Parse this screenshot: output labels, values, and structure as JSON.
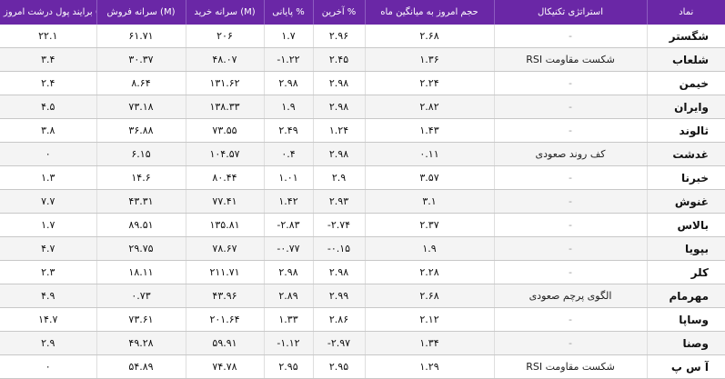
{
  "headers": {
    "c1": "برایند پول درشت امروز (B)",
    "c2": "سرانه فروش (M)",
    "c3": "سرانه خرید (M)",
    "c4": "پایانی %",
    "c5": "آخرین %",
    "c6": "حجم امروز به میانگین ماه",
    "c7": "استراتژی تکنیکال",
    "c8": "نماد"
  },
  "rows": [
    {
      "big_money": "۲۲.۱",
      "sell_per_capita": "۶۱.۷۱",
      "buy_per_capita": "۲۰۶",
      "close_pct": "۱.۷",
      "last_pct": "۲.۹۶",
      "vol_ratio": "۲.۶۸",
      "strategy": "-",
      "symbol": "شگستر"
    },
    {
      "big_money": "۳.۴",
      "sell_per_capita": "۳۰.۳۷",
      "buy_per_capita": "۴۸.۰۷",
      "close_pct": "-۱.۲۲",
      "last_pct": "۲.۴۵",
      "vol_ratio": "۱.۳۶",
      "strategy": "شکست مقاومت RSI",
      "symbol": "شلعاب"
    },
    {
      "big_money": "۲.۴",
      "sell_per_capita": "۸.۶۴",
      "buy_per_capita": "۱۳۱.۶۲",
      "close_pct": "۲.۹۸",
      "last_pct": "۲.۹۸",
      "vol_ratio": "۲.۲۴",
      "strategy": "-",
      "symbol": "خیمن"
    },
    {
      "big_money": "۴.۵",
      "sell_per_capita": "۷۳.۱۸",
      "buy_per_capita": "۱۳۸.۳۳",
      "close_pct": "۱.۹",
      "last_pct": "۲.۹۸",
      "vol_ratio": "۲.۸۲",
      "strategy": "-",
      "symbol": "وایران"
    },
    {
      "big_money": "۳.۸",
      "sell_per_capita": "۳۶.۸۸",
      "buy_per_capita": "۷۳.۵۵",
      "close_pct": "۲.۴۹",
      "last_pct": "۱.۲۴",
      "vol_ratio": "۱.۴۳",
      "strategy": "-",
      "symbol": "ثالوند"
    },
    {
      "big_money": "۰",
      "sell_per_capita": "۶.۱۵",
      "buy_per_capita": "۱۰۴.۵۷",
      "close_pct": "۰.۴",
      "last_pct": "۲.۹۸",
      "vol_ratio": "۰.۱۱",
      "strategy": "کف روند صعودی",
      "symbol": "غدشت"
    },
    {
      "big_money": "۱.۳",
      "sell_per_capita": "۱۴.۶",
      "buy_per_capita": "۸۰.۴۴",
      "close_pct": "۱.۰۱",
      "last_pct": "۲.۹",
      "vol_ratio": "۳.۵۷",
      "strategy": "-",
      "symbol": "خبرنا"
    },
    {
      "big_money": "۷.۷",
      "sell_per_capita": "۴۳.۳۱",
      "buy_per_capita": "۷۷.۴۱",
      "close_pct": "۱.۴۲",
      "last_pct": "۲.۹۳",
      "vol_ratio": "۳.۱",
      "strategy": "-",
      "symbol": "غنوش"
    },
    {
      "big_money": "۱.۷",
      "sell_per_capita": "۸۹.۵۱",
      "buy_per_capita": "۱۳۵.۸۱",
      "close_pct": "-۲.۸۳",
      "last_pct": "-۲.۷۴",
      "vol_ratio": "۲.۳۷",
      "strategy": "-",
      "symbol": "بالاس"
    },
    {
      "big_money": "۴.۷",
      "sell_per_capita": "۲۹.۷۵",
      "buy_per_capita": "۷۸.۶۷",
      "close_pct": "-۰.۷۷",
      "last_pct": "-۰.۱۵",
      "vol_ratio": "۱.۹",
      "strategy": "-",
      "symbol": "بپویا"
    },
    {
      "big_money": "۲.۳",
      "sell_per_capita": "۱۸.۱۱",
      "buy_per_capita": "۲۱۱.۷۱",
      "close_pct": "۲.۹۸",
      "last_pct": "۲.۹۸",
      "vol_ratio": "۲.۲۸",
      "strategy": "-",
      "symbol": "کلر"
    },
    {
      "big_money": "۴.۹",
      "sell_per_capita": "۰.۷۳",
      "buy_per_capita": "۴۳.۹۶",
      "close_pct": "۲.۸۹",
      "last_pct": "۲.۹۹",
      "vol_ratio": "۲.۶۸",
      "strategy": "الگوی پرچم صعودی",
      "symbol": "مهرمام"
    },
    {
      "big_money": "۱۴.۷",
      "sell_per_capita": "۷۳.۶۱",
      "buy_per_capita": "۲۰۱.۶۴",
      "close_pct": "۱.۳۳",
      "last_pct": "۲.۸۶",
      "vol_ratio": "۲.۱۲",
      "strategy": "-",
      "symbol": "وساپا"
    },
    {
      "big_money": "۲.۹",
      "sell_per_capita": "۴۹.۲۸",
      "buy_per_capita": "۵۹.۹۱",
      "close_pct": "-۱.۱۲",
      "last_pct": "-۲.۹۷",
      "vol_ratio": "۱.۳۴",
      "strategy": "-",
      "symbol": "وصنا"
    },
    {
      "big_money": "۰",
      "sell_per_capita": "۵۴.۸۹",
      "buy_per_capita": "۷۴.۷۸",
      "close_pct": "۲.۹۵",
      "last_pct": "۲.۹۵",
      "vol_ratio": "۱.۲۹",
      "strategy": "شکست مقاومت RSI",
      "symbol": "آ س پ"
    }
  ]
}
